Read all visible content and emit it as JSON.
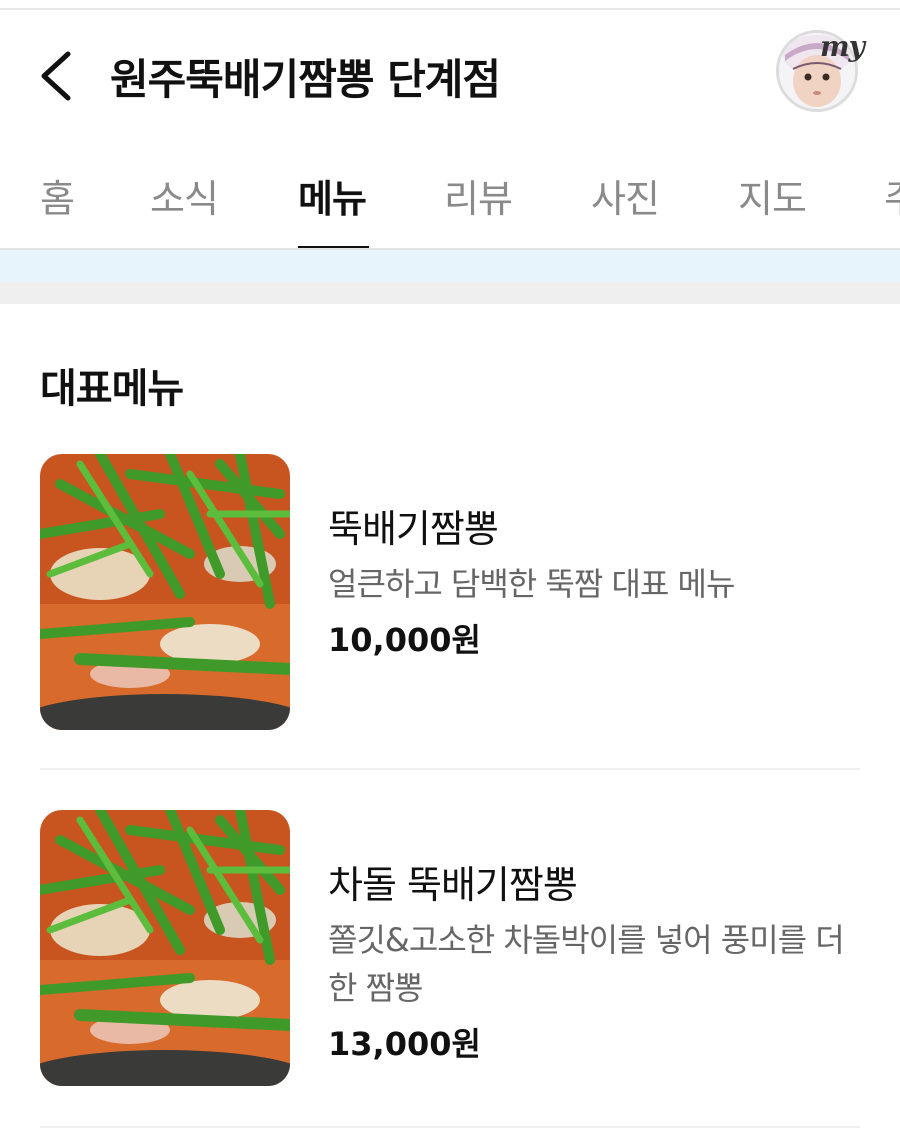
{
  "header": {
    "title": "원주뚝배기짬뽕 단계점",
    "avatar_badge": "my"
  },
  "tabs": [
    {
      "label": "홈"
    },
    {
      "label": "소식"
    },
    {
      "label": "메뉴"
    },
    {
      "label": "리뷰"
    },
    {
      "label": "사진"
    },
    {
      "label": "지도"
    },
    {
      "label": "주"
    }
  ],
  "active_tab": "메뉴",
  "section": {
    "title": "대표메뉴"
  },
  "menu_items": [
    {
      "name": "뚝배기짬뽕",
      "description": "얼큰하고 담백한 뚝짬 대표 메뉴",
      "price": "10,000원"
    },
    {
      "name": "차돌 뚝배기짬뽕",
      "description": "쫄깃&고소한 차돌박이를 넣어 풍미를 더한 짬뽕",
      "price": "13,000원"
    }
  ],
  "colors": {
    "text_primary": "#111111",
    "text_secondary": "#666666",
    "tab_inactive": "#8a8a8a",
    "notice_strip": "#e8f4fc",
    "divider": "#efefef"
  }
}
